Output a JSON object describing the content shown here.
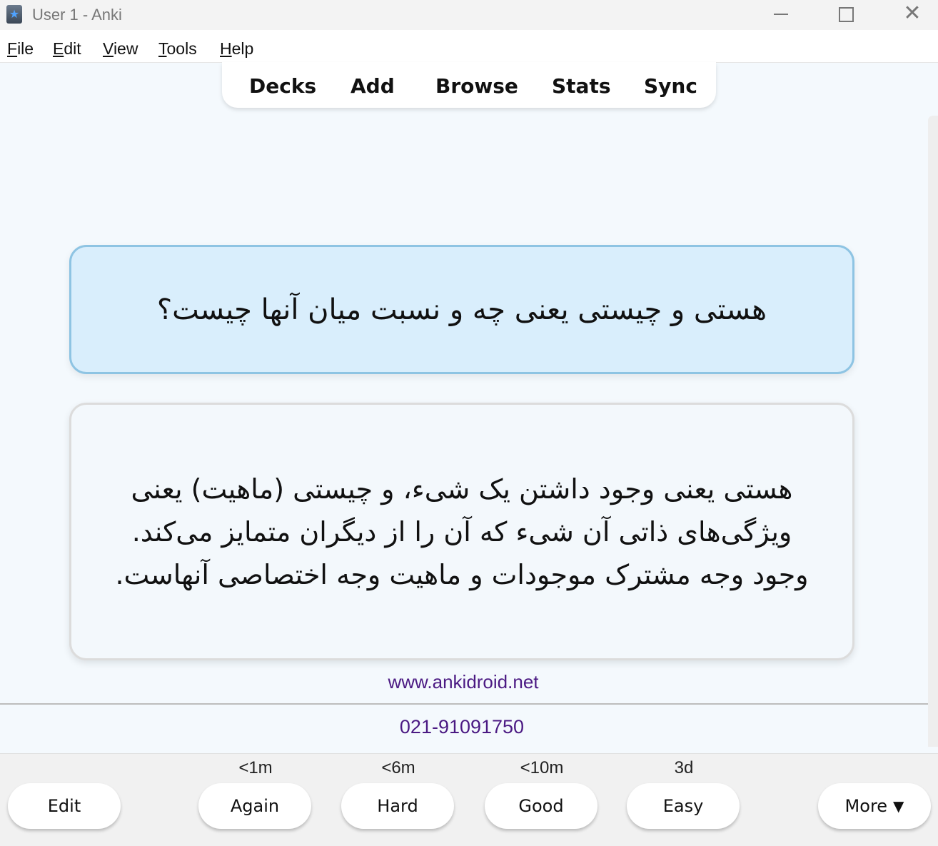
{
  "window": {
    "title": "User 1 - Anki",
    "close_glyph": "✕"
  },
  "menu": [
    {
      "accel": "F",
      "rest": "ile"
    },
    {
      "accel": "E",
      "rest": "dit"
    },
    {
      "accel": "V",
      "rest": "iew"
    },
    {
      "accel": "T",
      "rest": "ools"
    },
    {
      "accel": "H",
      "rest": "elp"
    }
  ],
  "toolbar": {
    "decks": "Decks",
    "add": "Add",
    "browse": "Browse",
    "stats": "Stats",
    "sync": "Sync"
  },
  "card": {
    "question": "هستی و چیستی یعنی چه و نسبت میان آنها چیست؟",
    "answer": "هستی یعنی وجود داشتن یک شیء، و چیستی (ماهیت) یعنی ویژگی‌های ذاتی آن شیء که آن را از دیگران متمایز می‌کند. وجود وجه مشترک موجودات و ماهیت وجه اختصاصی آنهاست.",
    "website": "www.ankidroid.net",
    "phone": "021-91091750"
  },
  "answer_buttons": {
    "edit": "Edit",
    "again": {
      "label": "Again",
      "interval": "<1m"
    },
    "hard": {
      "label": "Hard",
      "interval": "<6m"
    },
    "good": {
      "label": "Good",
      "interval": "<10m"
    },
    "easy": {
      "label": "Easy",
      "interval": "3d"
    },
    "more": "More",
    "more_arrow": "▼"
  },
  "colors": {
    "question_bg": "#d9eefc",
    "question_border": "#8ec4e3",
    "link_color": "#4b1a83"
  }
}
